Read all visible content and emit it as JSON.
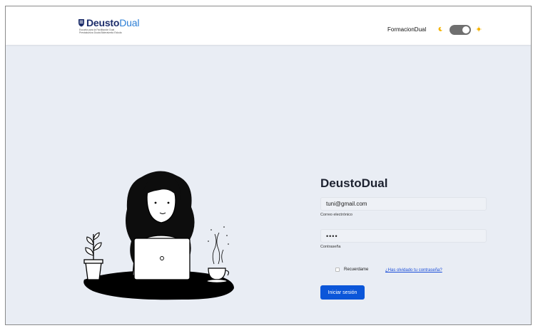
{
  "header": {
    "logo": {
      "brand_bold": "Deusto",
      "brand_light": "Dual",
      "subtitle_line1": "Escuela para la Facilitación Dual",
      "subtitle_line2": "Prestakuntza Duala Bideratzeko Eskola"
    },
    "username": "FormacionDual",
    "theme_toggle": {
      "dark_mode": false
    },
    "icons": {
      "moon": "moon-icon",
      "sun": "sun-icon"
    }
  },
  "login": {
    "title": "DeustoDual",
    "email": {
      "value": "tuni@gmail.com",
      "label": "Correo electrónico"
    },
    "password": {
      "value": "••••",
      "label": "Contraseña"
    },
    "remember_label": "Recuerdame",
    "forgot_link": "¿Has olvidado tu contraseña?",
    "submit_label": "Iniciar sesión"
  },
  "colors": {
    "background": "#e9edf4",
    "primary": "#0b56d9",
    "link": "#1a4dd8",
    "brand_dark": "#1b2c6a",
    "brand_light": "#2d7fd6",
    "accent_sun": "#f5b400"
  }
}
